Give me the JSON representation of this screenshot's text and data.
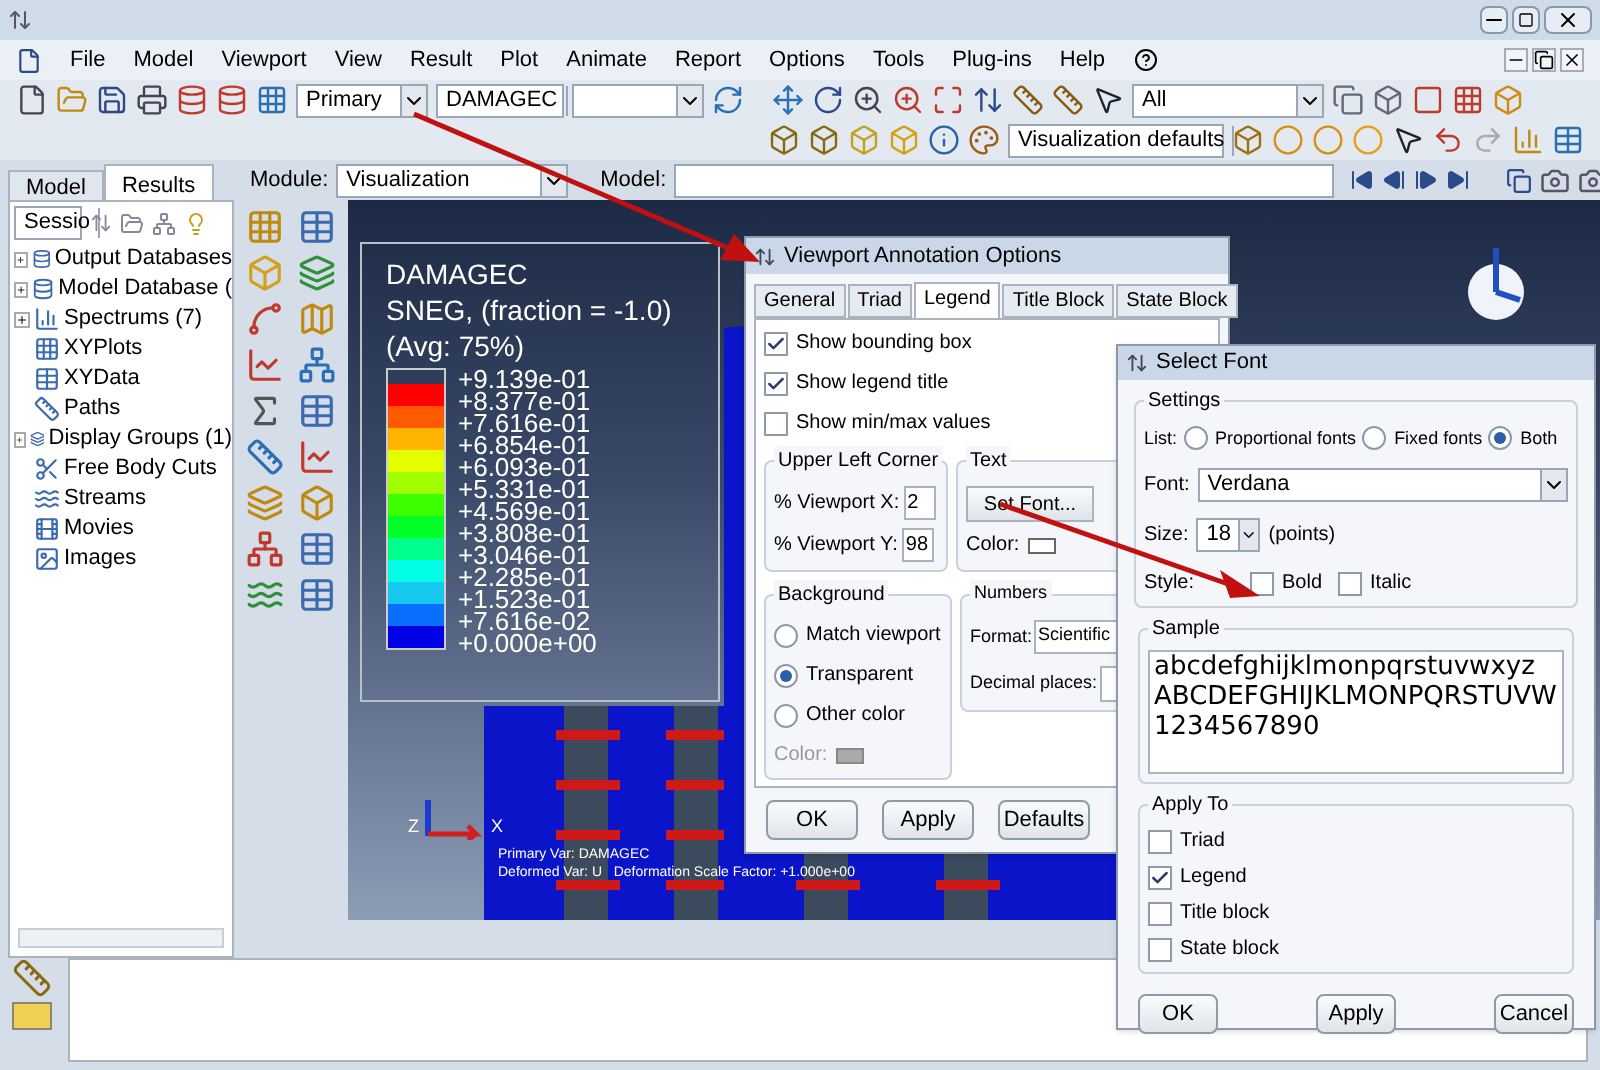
{
  "menu": [
    "File",
    "Model",
    "Viewport",
    "View",
    "Result",
    "Plot",
    "Animate",
    "Report",
    "Options",
    "Tools",
    "Plug-ins",
    "Help"
  ],
  "toolbar": {
    "primary_combo": "Primary",
    "variable_combo": "DAMAGEC",
    "selection_combo": "All",
    "defaults_combo": "Visualization defaults"
  },
  "left_panel": {
    "tabs": [
      {
        "label": "Model",
        "selected": false
      },
      {
        "label": "Results",
        "selected": true
      }
    ],
    "session_combo": "Sessio",
    "tree": [
      {
        "label": "Output Databases",
        "expandable": true
      },
      {
        "label": "Model Database (",
        "expandable": true
      },
      {
        "label": "Spectrums (7)",
        "expandable": true
      },
      {
        "label": "XYPlots",
        "expandable": false
      },
      {
        "label": "XYData",
        "expandable": false
      },
      {
        "label": "Paths",
        "expandable": false
      },
      {
        "label": "Display Groups (1)",
        "expandable": true
      },
      {
        "label": "Free Body Cuts",
        "expandable": false
      },
      {
        "label": "Streams",
        "expandable": false
      },
      {
        "label": "Movies",
        "expandable": false
      },
      {
        "label": "Images",
        "expandable": false
      }
    ]
  },
  "module_bar": {
    "module_label": "Module:",
    "module": "Visualization",
    "model_label": "Model:"
  },
  "viewport": {
    "legend": {
      "title": [
        "DAMAGEC",
        "SNEG, (fraction = -1.0)",
        "(Avg: 75%)"
      ],
      "labels": [
        "+9.139e-01",
        "+8.377e-01",
        "+7.616e-01",
        "+6.854e-01",
        "+6.093e-01",
        "+5.331e-01",
        "+4.569e-01",
        "+3.808e-01",
        "+3.046e-01",
        "+2.285e-01",
        "+1.523e-01",
        "+7.616e-02",
        "+0.000e+00"
      ],
      "bins": [
        {
          "color": "#ff0000"
        },
        {
          "color": "#ff5a00"
        },
        {
          "color": "#ffb400"
        },
        {
          "color": "#e6ff00"
        },
        {
          "color": "#a0ff00"
        },
        {
          "color": "#3cff00"
        },
        {
          "color": "#00ff28"
        },
        {
          "color": "#00ff8c"
        },
        {
          "color": "#00ffe6"
        },
        {
          "color": "#14c8f0"
        },
        {
          "color": "#0a6eff"
        },
        {
          "color": "#0000e6"
        }
      ]
    },
    "triad": {
      "z": "Z",
      "x": "X"
    },
    "info": [
      "Primary Var: DAMAGEC",
      "Deformed Var: U   Deformation Scale Factor: +1.000e+00"
    ]
  },
  "annotation_dialog": {
    "title": "Viewport Annotation Options",
    "tabs": [
      {
        "label": "General",
        "selected": false
      },
      {
        "label": "Triad",
        "selected": false
      },
      {
        "label": "Legend",
        "selected": true
      },
      {
        "label": "Title Block",
        "selected": false
      },
      {
        "label": "State Block",
        "selected": false
      }
    ],
    "checks": [
      {
        "label": "Show bounding box",
        "checked": true
      },
      {
        "label": "Show legend title",
        "checked": true
      },
      {
        "label": "Show min/max values",
        "checked": false
      }
    ],
    "corner": {
      "title": "Upper Left Corner",
      "fields": [
        {
          "label": "% Viewport X:",
          "value": "2"
        },
        {
          "label": "% Viewport Y:",
          "value": "98"
        }
      ]
    },
    "text": {
      "title": "Text",
      "button": "Set Font...",
      "color_label": "Color:"
    },
    "background": {
      "title": "Background",
      "options": [
        {
          "label": "Match viewport",
          "selected": false
        },
        {
          "label": "Transparent",
          "selected": true
        },
        {
          "label": "Other color",
          "selected": false
        }
      ],
      "color_label": "Color:"
    },
    "numbers": {
      "title": "Numbers",
      "format_label": "Format:",
      "format": "Scientific",
      "decimal_label": "Decimal places:"
    },
    "buttons": [
      "OK",
      "Apply",
      "Defaults"
    ]
  },
  "font_dialog": {
    "title": "Select Font",
    "settings_title": "Settings",
    "list_label": "List:",
    "list_options": [
      {
        "label": "Proportional fonts",
        "selected": false
      },
      {
        "label": "Fixed fonts",
        "selected": false
      },
      {
        "label": "Both",
        "selected": true
      }
    ],
    "font_label": "Font:",
    "font": "Verdana",
    "size_label": "Size:",
    "size": "18",
    "size_unit": "(points)",
    "style_label": "Style:",
    "styles": [
      {
        "label": "Bold",
        "checked": false
      },
      {
        "label": "Italic",
        "checked": false
      }
    ],
    "sample_title": "Sample",
    "sample": [
      "abcdefghijklmonpqrstuvwxyz",
      "ABCDEFGHIJKLMONPQRSTUVW",
      "1234567890"
    ],
    "apply_title": "Apply To",
    "apply": [
      {
        "label": "Triad",
        "checked": false
      },
      {
        "label": "Legend",
        "checked": true
      },
      {
        "label": "Title block",
        "checked": false
      },
      {
        "label": "State block",
        "checked": false
      }
    ],
    "buttons": [
      "OK",
      "Apply",
      "Cancel"
    ]
  }
}
